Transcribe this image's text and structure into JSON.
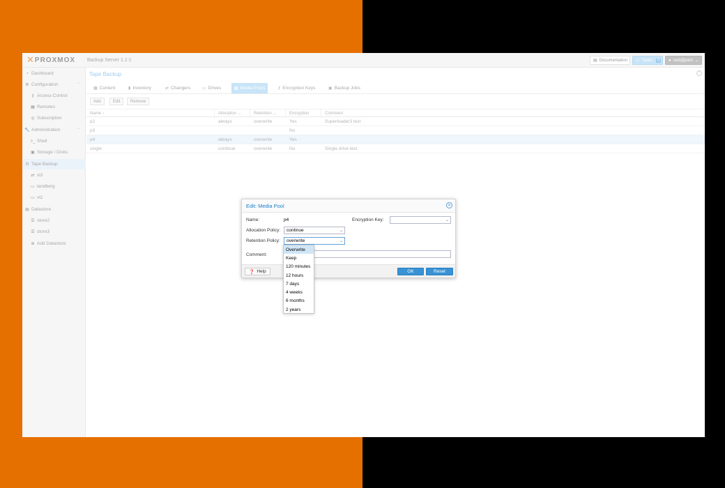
{
  "header": {
    "logo_text": "PROXMOX",
    "version": "Backup Server 1.1-1",
    "documentation": "Documentation",
    "tasks": "Tasks",
    "tasks_count": "0",
    "user": "root@pam"
  },
  "sidebar": {
    "items": [
      {
        "label": "Dashboard"
      },
      {
        "label": "Configuration"
      },
      {
        "label": "Access Control"
      },
      {
        "label": "Remotes"
      },
      {
        "label": "Subscription"
      },
      {
        "label": "Administration"
      },
      {
        "label": "Shell"
      },
      {
        "label": "Storage / Disks"
      },
      {
        "label": "Tape Backup"
      },
      {
        "label": "sl3"
      },
      {
        "label": "tandberg"
      },
      {
        "label": "vt1"
      },
      {
        "label": "Datastore"
      },
      {
        "label": "store2"
      },
      {
        "label": "store3"
      },
      {
        "label": "Add Datastore"
      }
    ]
  },
  "main": {
    "title": "Tape Backup",
    "tabs": [
      "Content",
      "Inventory",
      "Changers",
      "Drives",
      "Media Pools",
      "Encryption Keys",
      "Backup Jobs"
    ],
    "toolbar": {
      "add": "Add",
      "edit": "Edit",
      "remove": "Remove"
    },
    "columns": [
      "Name ↑",
      "Allocation ...",
      "Retention ...",
      "Encryption",
      "Comment"
    ],
    "rows": [
      {
        "name": "p2",
        "allocation": "always",
        "retention": "overwrite",
        "encryption": "Yes",
        "comment": "Superloader3 test"
      },
      {
        "name": "p3",
        "allocation": "",
        "retention": "",
        "encryption": "No",
        "comment": ""
      },
      {
        "name": "p4",
        "allocation": "always",
        "retention": "overwrite",
        "encryption": "Yes",
        "comment": ""
      },
      {
        "name": "single",
        "allocation": "continue",
        "retention": "overwrite",
        "encryption": "No",
        "comment": "Single drive test"
      }
    ]
  },
  "dialog": {
    "title": "Edit: Media Pool",
    "name_label": "Name:",
    "name_value": "p4",
    "allocation_label": "Allocation Policy:",
    "allocation_value": "continue",
    "retention_label": "Retention Policy:",
    "retention_value": "overwrite",
    "encryption_label": "Encryption Key:",
    "encryption_value": "",
    "comment_label": "Comment:",
    "comment_value": "",
    "help": "Help",
    "ok": "OK",
    "reset": "Reset"
  },
  "retention_options": [
    "Overwrite",
    "Keep",
    "120 minutes",
    "12 hours",
    "7 days",
    "4 weeks",
    "6 months",
    "2 years"
  ],
  "colors": {
    "accent": "#3892d4",
    "brand_orange": "#e57000",
    "selected_tab": "#bfe0f7"
  }
}
